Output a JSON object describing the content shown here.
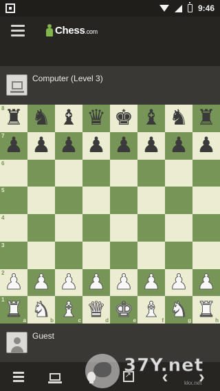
{
  "status_bar": {
    "time": "9:46",
    "icons": [
      "qr-code-icon",
      "wifi-icon",
      "signal-icon",
      "battery-icon"
    ]
  },
  "app_bar": {
    "logo_text": "Chess",
    "logo_suffix": ".com",
    "icons": [
      "menu-icon",
      "pawn-logo-icon"
    ]
  },
  "players": {
    "top": {
      "name": "Computer (Level 3)",
      "avatar_icon": "computer-avatar-icon"
    },
    "bottom": {
      "name": "Guest",
      "avatar_icon": "guest-avatar-icon"
    }
  },
  "board": {
    "files": [
      "a",
      "b",
      "c",
      "d",
      "e",
      "f",
      "g",
      "h"
    ],
    "ranks": [
      "8",
      "7",
      "6",
      "5",
      "4",
      "3",
      "2",
      "1"
    ],
    "light_color": "#ebecd0",
    "dark_color": "#779556",
    "position": [
      [
        "br",
        "bn",
        "bb",
        "bq",
        "bk",
        "bb",
        "bn",
        "br"
      ],
      [
        "bp",
        "bp",
        "bp",
        "bp",
        "bp",
        "bp",
        "bp",
        "bp"
      ],
      [
        "",
        "",
        "",
        "",
        "",
        "",
        "",
        ""
      ],
      [
        "",
        "",
        "",
        "",
        "",
        "",
        "",
        ""
      ],
      [
        "",
        "",
        "",
        "",
        "",
        "",
        "",
        ""
      ],
      [
        "",
        "",
        "",
        "",
        "",
        "",
        "",
        ""
      ],
      [
        "wp",
        "wp",
        "wp",
        "wp",
        "wp",
        "wp",
        "wp",
        "wp"
      ],
      [
        "wr",
        "wn",
        "wb",
        "wq",
        "wk",
        "wb",
        "wn",
        "wr"
      ]
    ]
  },
  "bottom_nav": {
    "items": [
      {
        "name": "moves-list-icon"
      },
      {
        "name": "computer-options-icon"
      },
      {
        "name": "hint-bulb-icon"
      },
      {
        "name": "expand-icon"
      },
      {
        "name": "back-arrow-icon",
        "glyph": "‹"
      },
      {
        "name": "forward-arrow-icon",
        "glyph": "›"
      }
    ]
  },
  "watermark": {
    "text": "37Y.net",
    "subtext": "kkx.net"
  }
}
